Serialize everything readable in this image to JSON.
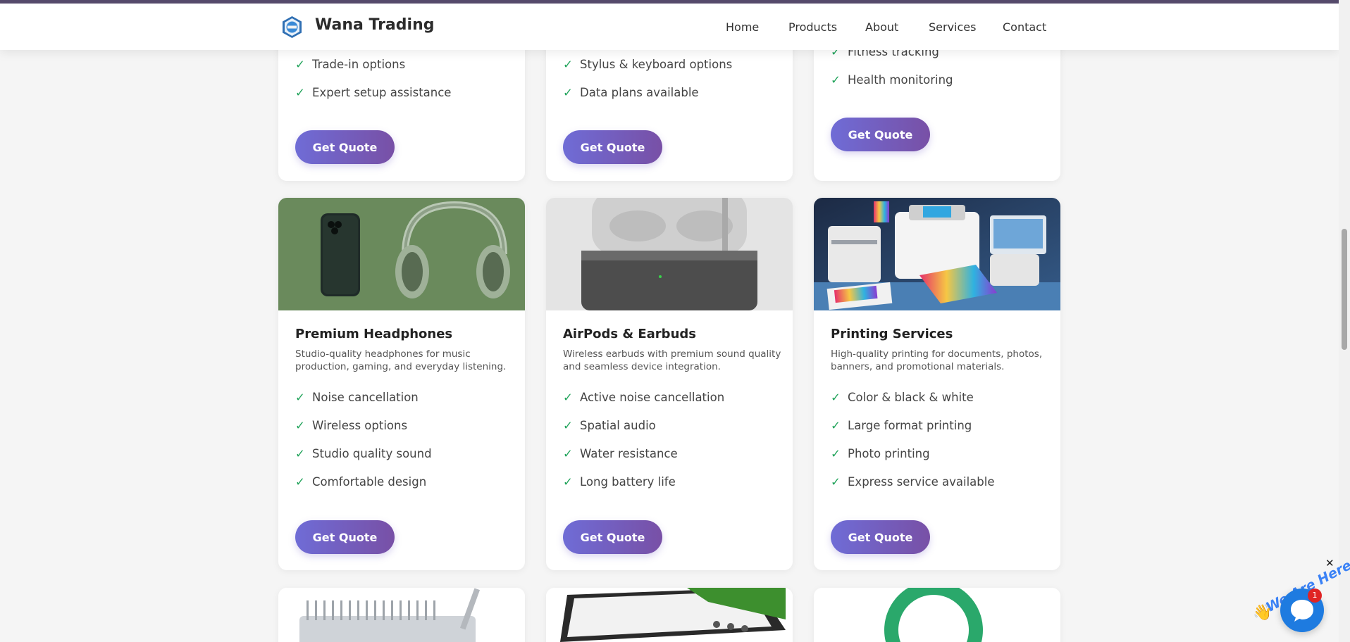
{
  "header": {
    "brand": "Wana Trading",
    "nav": [
      "Home",
      "Products",
      "About",
      "Services",
      "Contact"
    ]
  },
  "top_cards": [
    {
      "features": [
        "Trade-in options",
        "Expert setup assistance"
      ],
      "button": "Get Quote"
    },
    {
      "features": [
        "Stylus & keyboard options",
        "Data plans available"
      ],
      "button": "Get Quote"
    },
    {
      "features": [
        "Fitness tracking",
        "Health monitoring"
      ],
      "button": "Get Quote"
    }
  ],
  "cards": [
    {
      "title": "Premium Headphones",
      "description": "Studio-quality headphones for music production, gaming, and everyday listening.",
      "features": [
        "Noise cancellation",
        "Wireless options",
        "Studio quality sound",
        "Comfortable design"
      ],
      "button": "Get Quote"
    },
    {
      "title": "AirPods & Earbuds",
      "description": "Wireless earbuds with premium sound quality and seamless device integration.",
      "features": [
        "Active noise cancellation",
        "Spatial audio",
        "Water resistance",
        "Long battery life"
      ],
      "button": "Get Quote"
    },
    {
      "title": "Printing Services",
      "description": "High-quality printing for documents, photos, banners, and promotional materials.",
      "features": [
        "Color & black & white",
        "Large format printing",
        "Photo printing",
        "Express service available"
      ],
      "button": "Get Quote"
    }
  ],
  "chat_widget": {
    "text": "We Are Here!",
    "badge": "1",
    "close": "✕"
  },
  "colors": {
    "accent_start": "#6f6cd6",
    "accent_end": "#7850a6",
    "check": "#20a35a",
    "chat": "#1e7be0"
  }
}
